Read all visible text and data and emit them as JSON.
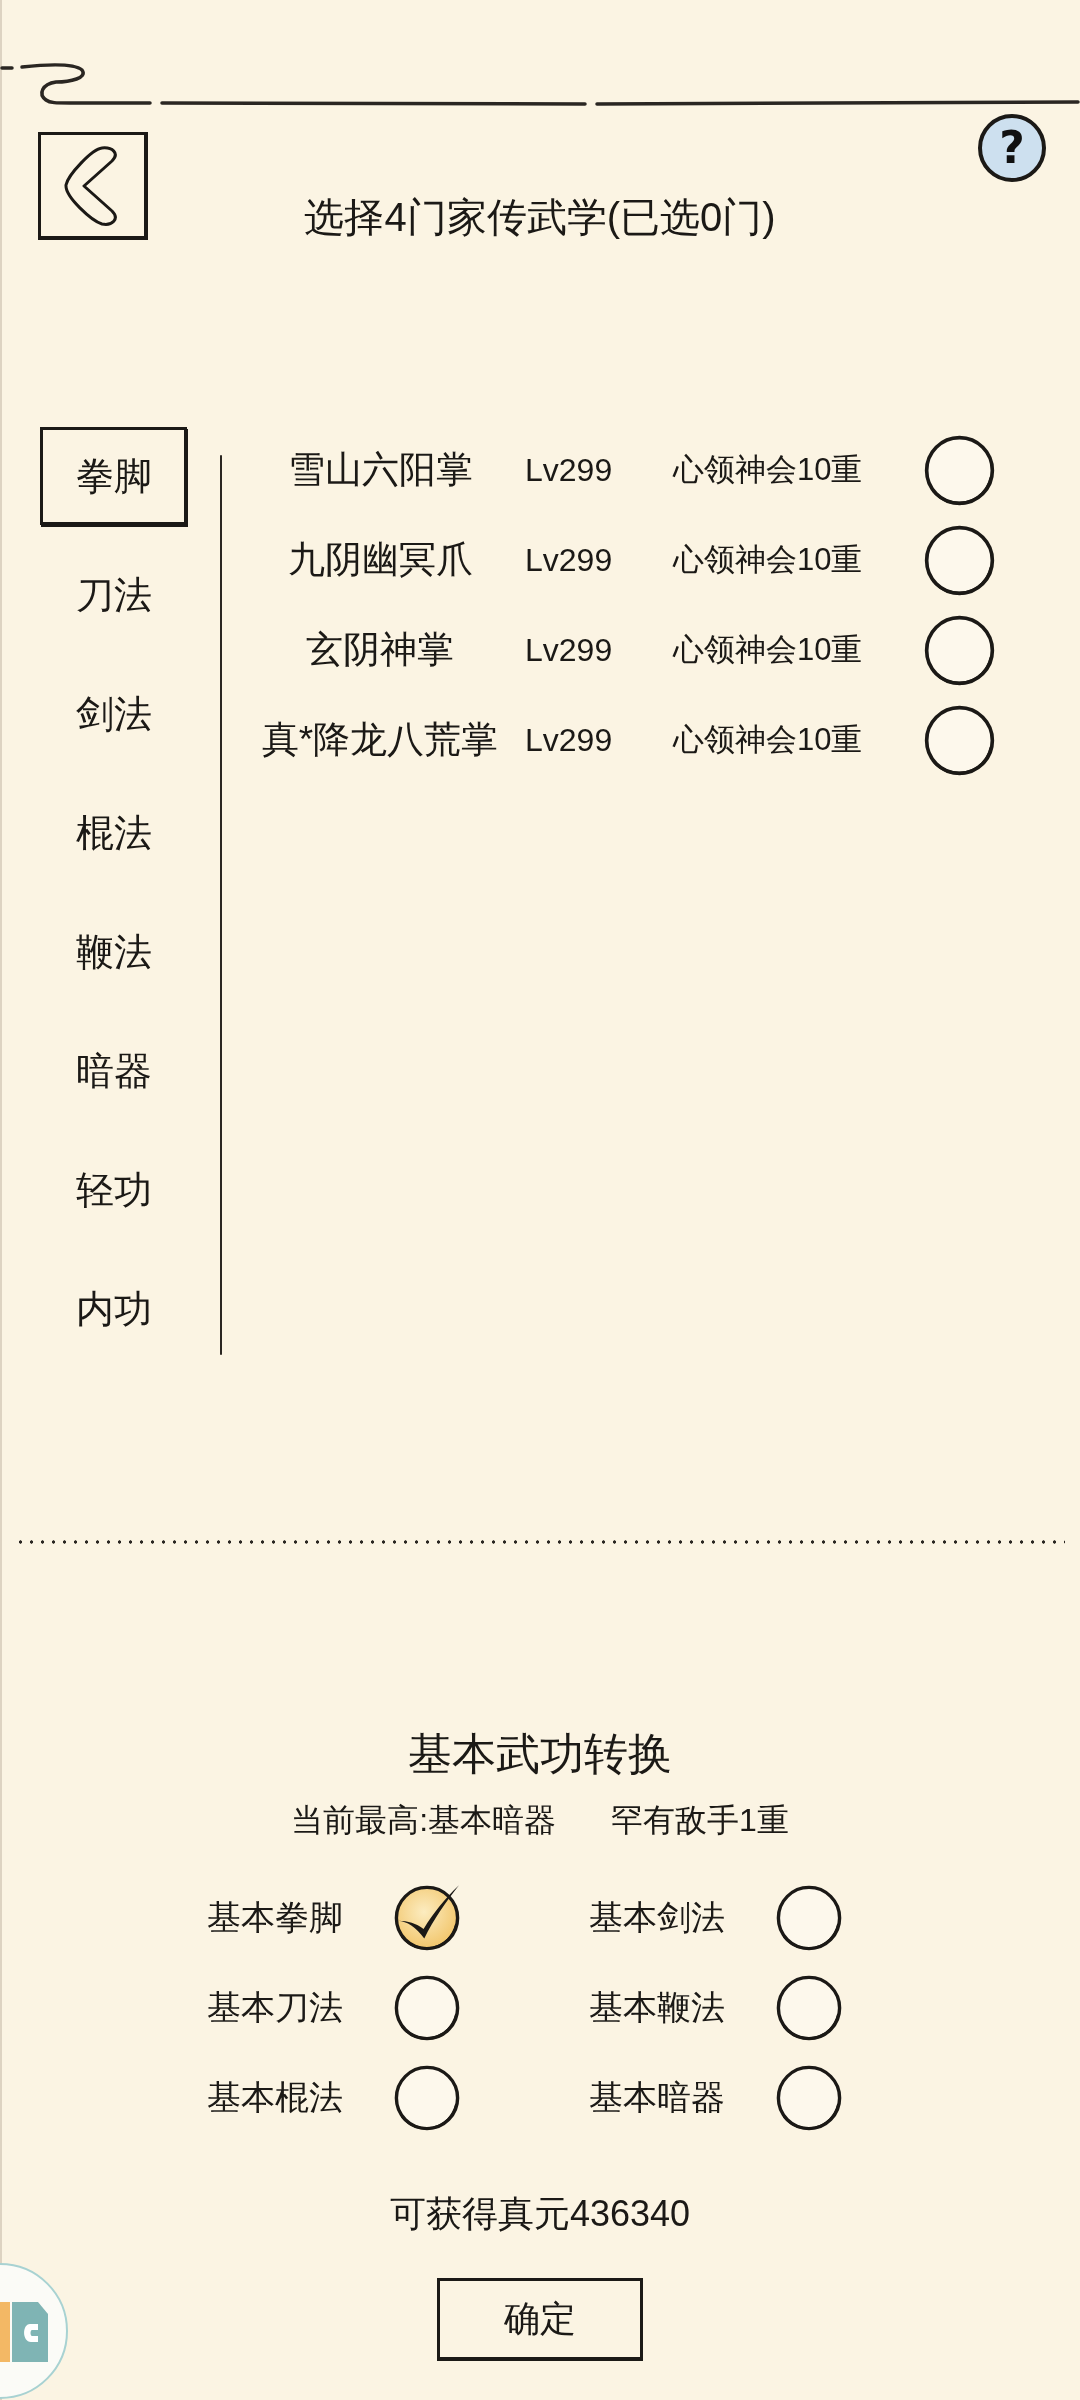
{
  "header": {
    "title": "选择4门家传武学(已选0门)",
    "help_button": "?"
  },
  "categories": [
    {
      "label": "拳脚",
      "selected": true
    },
    {
      "label": "刀法",
      "selected": false
    },
    {
      "label": "剑法",
      "selected": false
    },
    {
      "label": "棍法",
      "selected": false
    },
    {
      "label": "鞭法",
      "selected": false
    },
    {
      "label": "暗器",
      "selected": false
    },
    {
      "label": "轻功",
      "selected": false
    },
    {
      "label": "内功",
      "selected": false
    }
  ],
  "skills": [
    {
      "name": "雪山六阳掌",
      "lv": "Lv299",
      "mastery": "心领神会10重",
      "checked": false
    },
    {
      "name": "九阴幽冥爪",
      "lv": "Lv299",
      "mastery": "心领神会10重",
      "checked": false
    },
    {
      "name": "玄阴神掌",
      "lv": "Lv299",
      "mastery": "心领神会10重",
      "checked": false
    },
    {
      "name": "真*降龙八荒掌",
      "lv": "Lv299",
      "mastery": "心领神会10重",
      "checked": false
    }
  ],
  "conversion": {
    "title": "基本武功转换",
    "current_best": "当前最高:基本暗器",
    "rank": "罕有敌手1重",
    "options": [
      {
        "label": "基本拳脚",
        "checked": true
      },
      {
        "label": "基本剑法",
        "checked": false
      },
      {
        "label": "基本刀法",
        "checked": false
      },
      {
        "label": "基本鞭法",
        "checked": false
      },
      {
        "label": "基本棍法",
        "checked": false
      },
      {
        "label": "基本暗器",
        "checked": false
      }
    ],
    "reward": "可获得真元436340",
    "confirm_button": "确定"
  }
}
